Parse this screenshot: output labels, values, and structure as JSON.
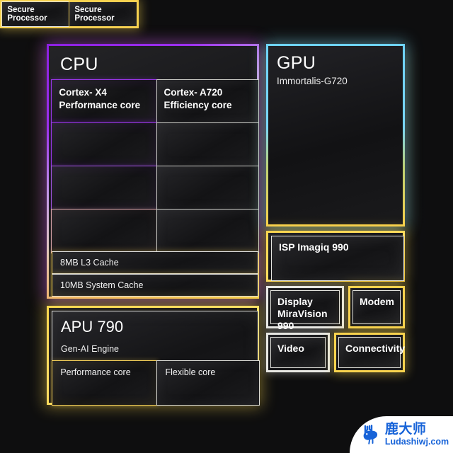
{
  "background_color": "#0e0e0f",
  "accents": {
    "purple": "#9a34ee",
    "cyan": "#6ed3f9",
    "yellow": "#f7d24e",
    "white": "#e8e8e6",
    "brand_blue": "#1763d8"
  },
  "cpu": {
    "title": "CPU",
    "cores": [
      {
        "name": "Cortex- X4",
        "role": "Performance core"
      },
      {
        "name": "Cortex- A720",
        "role": "Efficiency core"
      }
    ],
    "caches": [
      "8MB L3 Cache",
      "10MB System Cache"
    ]
  },
  "apu": {
    "title": "APU 790",
    "subtitle": "Gen-AI Engine",
    "cores": [
      "Performance core",
      "Flexible core"
    ]
  },
  "gpu": {
    "title": "GPU",
    "subtitle": "Immortalis-G720"
  },
  "isp": {
    "label": "ISP Imagiq 990"
  },
  "blocks": {
    "display_line1": "Display",
    "display_line2": "MiraVision 990",
    "modem": "Modem",
    "video": "Video",
    "connectivity": "Connectivity",
    "secure_processors": [
      "Secure Processor",
      "Secure Processor"
    ]
  },
  "watermark": {
    "cn_name": "鹿大师",
    "site": "Ludashiwj.com",
    "icon": "deer-logo-icon"
  }
}
